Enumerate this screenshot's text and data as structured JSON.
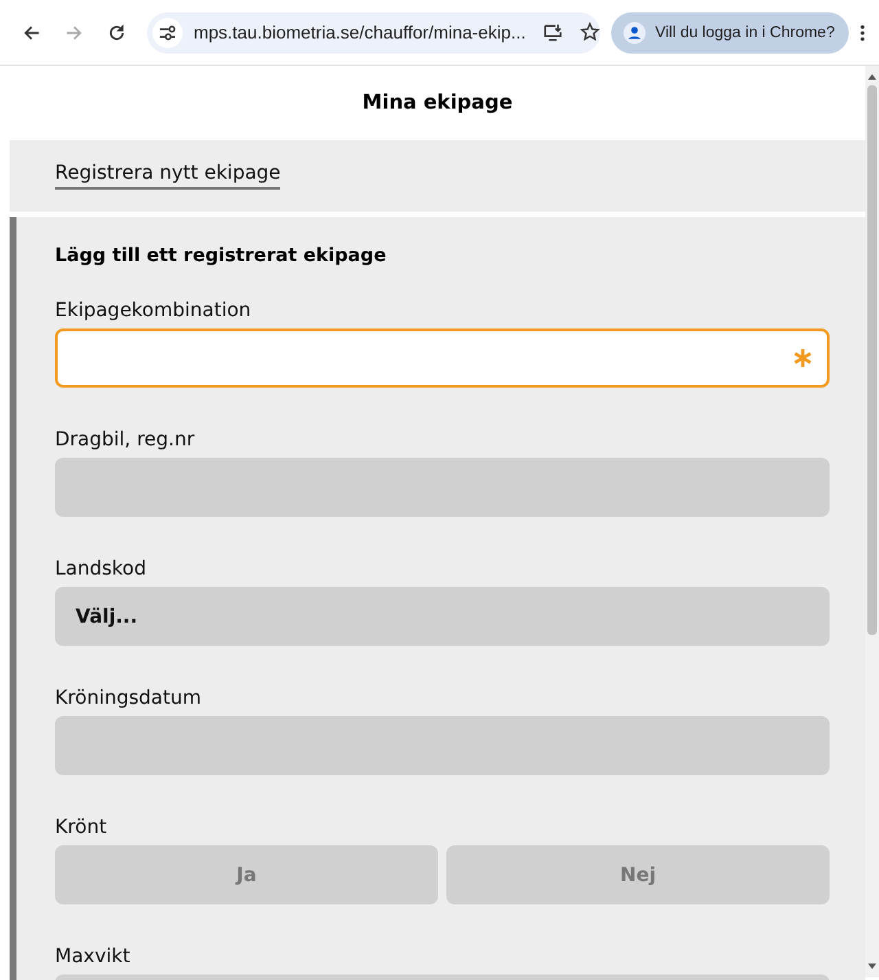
{
  "browser": {
    "back_disabled": false,
    "forward_disabled": true,
    "url": "mps.tau.biometria.se/chauffor/mina-ekip...",
    "profile_prompt": "Vill du logga in i Chrome?"
  },
  "page": {
    "title": "Mina ekipage",
    "link": "Registrera nytt ekipage"
  },
  "form": {
    "heading": "Lägg till ett registrerat ekipage",
    "fields": [
      {
        "kind": "text",
        "label": "Ekipagekombination",
        "focused": true,
        "required": true,
        "disabled": false
      },
      {
        "kind": "text",
        "label": "Dragbil, reg.nr",
        "focused": false,
        "required": false,
        "disabled": true
      },
      {
        "kind": "select",
        "label": "Landskod",
        "value": "Välj..."
      },
      {
        "kind": "text",
        "label": "Kröningsdatum",
        "focused": false,
        "required": false,
        "disabled": true
      },
      {
        "kind": "toggle",
        "label": "Krönt",
        "options": [
          {
            "label": "Ja",
            "selected": false
          },
          {
            "label": "Nej",
            "selected": false
          }
        ]
      },
      {
        "kind": "text",
        "label": "Maxvikt",
        "focused": false,
        "required": false,
        "disabled": true
      }
    ]
  }
}
